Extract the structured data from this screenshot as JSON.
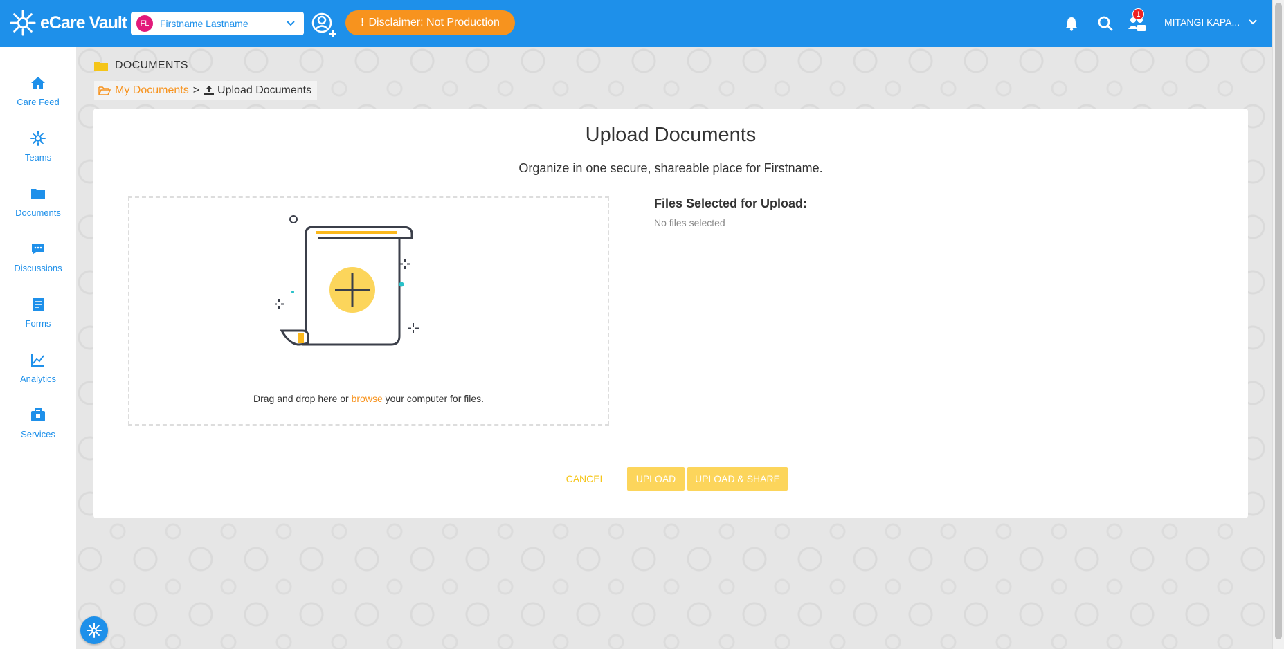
{
  "app": {
    "name": "eCare Vault"
  },
  "header": {
    "profile": {
      "initials": "FL",
      "name": "Firstname Lastname"
    },
    "disclaimer": "Disclaimer: Not Production",
    "disclaimer_mark": "!",
    "notifications_badge": "1",
    "user_name": "MITANGI KAPA..."
  },
  "sidebar": {
    "items": [
      {
        "label": "Care Feed",
        "icon": "home-icon"
      },
      {
        "label": "Teams",
        "icon": "teams-icon"
      },
      {
        "label": "Documents",
        "icon": "folder-icon"
      },
      {
        "label": "Discussions",
        "icon": "chat-icon"
      },
      {
        "label": "Forms",
        "icon": "form-icon"
      },
      {
        "label": "Analytics",
        "icon": "chart-icon"
      },
      {
        "label": "Services",
        "icon": "briefcase-icon"
      }
    ]
  },
  "page": {
    "section": "DOCUMENTS",
    "breadcrumb": {
      "parent": "My Documents",
      "separator": ">",
      "current": "Upload Documents"
    }
  },
  "upload": {
    "title": "Upload Documents",
    "subtitle": "Organize in one secure, shareable place  for Firstname.",
    "drop_prefix": "Drag and drop here or",
    "browse": "browse",
    "drop_suffix": "your computer for files.",
    "files_label": "Files Selected for Upload:",
    "files_empty": "No files selected",
    "cancel": "CANCEL",
    "upload": "UPLOAD",
    "upload_share": "UPLOAD & SHARE"
  },
  "colors": {
    "primary": "#1e90ea",
    "accent": "#f7931e",
    "yellow": "#fcd55b"
  }
}
